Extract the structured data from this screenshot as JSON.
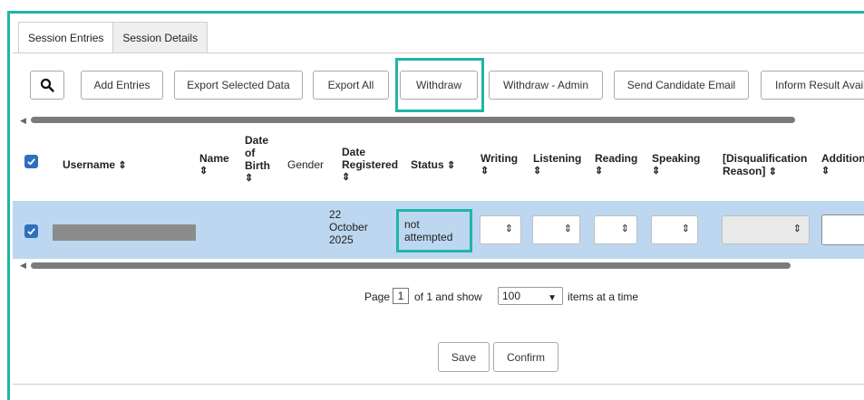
{
  "tabs": [
    {
      "label": "Session Entries",
      "active": true
    },
    {
      "label": "Session Details",
      "active": false
    }
  ],
  "toolbar": {
    "search_icon": "search-icon",
    "buttons": [
      "Add Entries",
      "Export Selected Data",
      "Export All",
      "Withdraw",
      "Withdraw - Admin",
      "Send Candidate Email",
      "Inform Result Available"
    ]
  },
  "table": {
    "headers": {
      "username": "Username",
      "name": "Name",
      "dob_1": "Date",
      "dob_2": "of",
      "dob_3": "Birth",
      "gender": "Gender",
      "registered_1": "Date",
      "registered_2": "Registered",
      "status": "Status",
      "writing": "Writing",
      "listening": "Listening",
      "reading": "Reading",
      "speaking": "Speaking",
      "disq_1": "[Disqualification",
      "disq_2": "Reason]",
      "additional": "Additional"
    },
    "sort_glyph": "⇕",
    "row": {
      "selected": true,
      "date_registered": [
        "22",
        "October",
        "2025"
      ],
      "status": [
        "not",
        "attempted"
      ]
    }
  },
  "pagination": {
    "page_label": "Page",
    "current_page": "1",
    "of_label": "of 1 and show",
    "per_page": "100",
    "items_label": "items at a time"
  },
  "actions": {
    "save": "Save",
    "confirm": "Confirm"
  },
  "colors": {
    "highlight": "#1fb5a8",
    "selected_row": "#bcd7ef",
    "checkbox": "#2f6fbd"
  }
}
